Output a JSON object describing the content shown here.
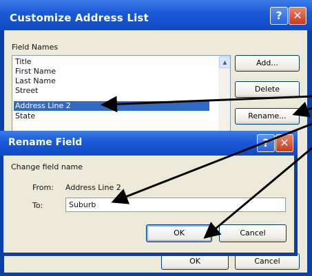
{
  "outer_dialog": {
    "title": "Customize Address List",
    "field_names_label": "Field Names",
    "fields": [
      "Title",
      "First Name",
      "Last Name",
      "Street",
      "Address Line 2",
      "State"
    ],
    "selected_field": "Address Line 2",
    "buttons": {
      "add": "Add...",
      "delete": "Delete",
      "rename": "Rename...",
      "ok": "OK",
      "cancel": "Cancel"
    },
    "help_glyph": "?",
    "close_glyph": "✕"
  },
  "rename_dialog": {
    "title": "Rename Field",
    "prompt": "Change field name",
    "from_label": "From:",
    "from_value": "Address Line 2",
    "to_label": "To:",
    "to_value": "Suburb",
    "buttons": {
      "ok": "OK",
      "cancel": "Cancel"
    },
    "help_glyph": "?",
    "close_glyph": "✕"
  },
  "annotation_color": "#000000",
  "selection_color": "#316ac5",
  "titlebar_color": "#0f49c4"
}
